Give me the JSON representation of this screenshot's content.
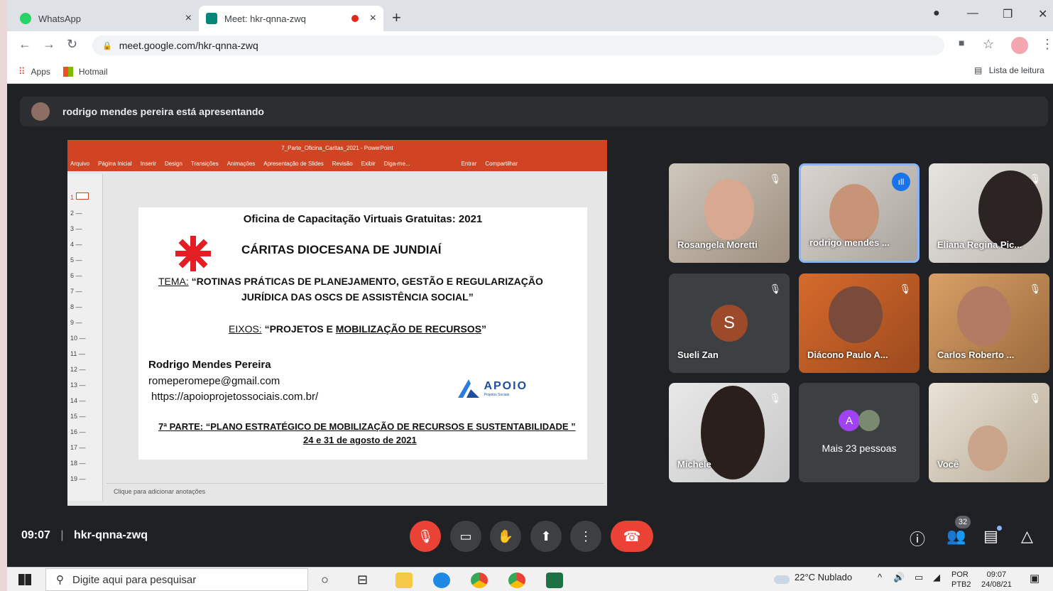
{
  "browser": {
    "tabs": [
      {
        "title": "WhatsApp",
        "icon": "whatsapp-icon",
        "close": "×"
      },
      {
        "title": "Meet: hkr-qnna-zwq",
        "icon": "meet-icon",
        "close": "×"
      }
    ],
    "new_tab": "+",
    "url": "meet.google.com/hkr-qnna-zwq",
    "bookmarks": [
      "Apps",
      "Hotmail"
    ],
    "reading_list": "Lista de leitura"
  },
  "meet": {
    "presenting_banner": "rodrigo mendes pereira está apresentando",
    "time": "09:07",
    "meeting_code": "hkr-qnna-zwq",
    "people_count": "32",
    "participants": [
      {
        "name": "Rosangela Moretti",
        "muted": true
      },
      {
        "name": "rodrigo mendes ...",
        "muted": false,
        "speaking": true
      },
      {
        "name": "Eliana Regina Pic...",
        "muted": true
      },
      {
        "name": "Sueli Zan",
        "muted": true,
        "initial": "S"
      },
      {
        "name": "Diácono Paulo A...",
        "muted": true
      },
      {
        "name": "Carlos Roberto ...",
        "muted": true
      },
      {
        "name": "Michele",
        "muted": true
      },
      {
        "name": "Mais 23 pessoas",
        "initial": "A"
      },
      {
        "name": "Você",
        "muted": true
      }
    ]
  },
  "ppt": {
    "window_title": "7_Parte_Oficina_Caritas_2021 - PowerPoint",
    "ribbon": [
      "Arquivo",
      "Página Inicial",
      "Inserir",
      "Design",
      "Transições",
      "Animações",
      "Apresentação de Slides",
      "Revisão",
      "Exibir",
      "Diga-me...",
      "Entrar",
      "Compartilhar"
    ],
    "notes_placeholder": "Clique para adicionar anotações",
    "slide": {
      "heading": "Oficina de Capacitação Virtuais Gratuitas: 2021",
      "org": "CÁRITAS DIOCESANA DE JUNDIAÍ",
      "tema_label": "TEMA:",
      "tema_line1": "“ROTINAS PRÁTICAS DE PLANEJAMENTO, GESTÃO E REGULARIZAÇÃO",
      "tema_line2": "JURÍDICA DAS OSCS DE ASSISTÊNCIA SOCIAL”",
      "eixos_label": "EIXOS:",
      "eixos_a": "“PROJETOS E ",
      "eixos_b": "MOBILIZAÇÃO DE RECURSOS",
      "eixos_c": "”",
      "presenter": "Rodrigo Mendes Pereira",
      "email": "romeperomepe@gmail.com",
      "site": "https://apoioprojetossociais.com.br/",
      "logo_text": "APOIO",
      "logo_sub": "Projetos Sociais",
      "part_label": "7ª PARTE:",
      "part_title": " “PLANO ESTRATÉGICO DE MOBILIZAÇÃO DE RECURSOS E SUSTENTABILIDADE ”",
      "dates": "24 e 31 de agosto de 2021"
    }
  },
  "taskbar": {
    "search_placeholder": "Digite aqui para pesquisar",
    "weather": "22°C  Nublado",
    "lang": "POR",
    "lang_sub": "PTB2",
    "clock_time": "09:07",
    "clock_date": "24/08/21"
  }
}
